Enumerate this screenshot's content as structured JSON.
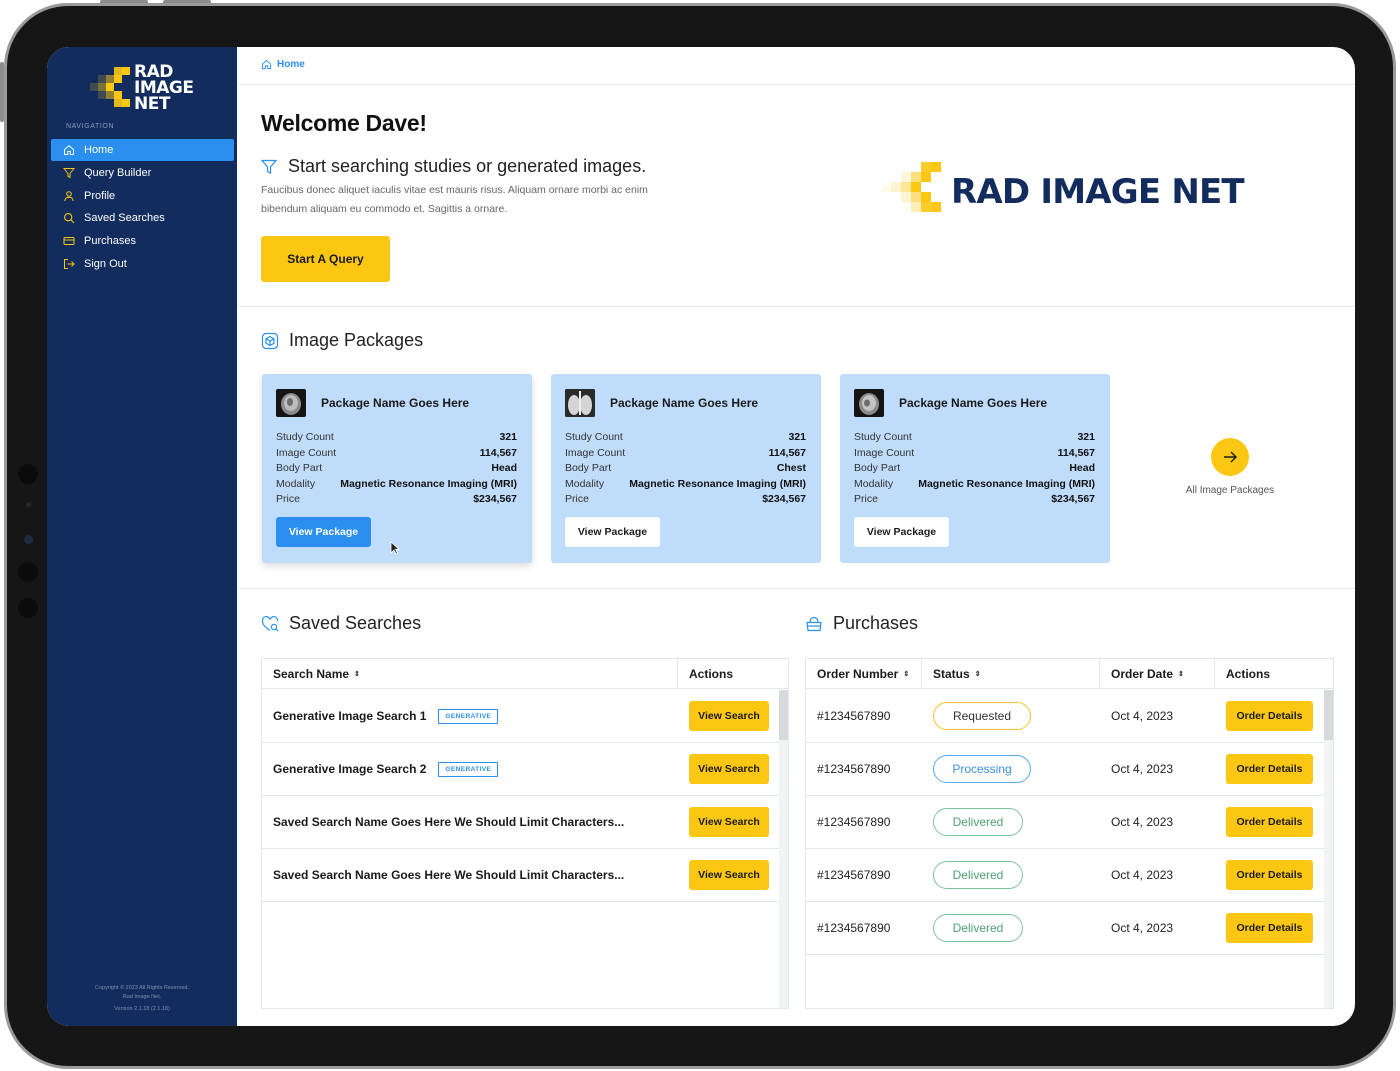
{
  "sidebar": {
    "logo_text": [
      "RAD",
      "IMAGE",
      "NET"
    ],
    "nav_heading": "NAVIGATION",
    "items": [
      {
        "label": "Home",
        "icon": "home-icon",
        "active": true
      },
      {
        "label": "Query Builder",
        "icon": "filter-icon",
        "active": false
      },
      {
        "label": "Profile",
        "icon": "user-icon",
        "active": false
      },
      {
        "label": "Saved Searches",
        "icon": "search-icon",
        "active": false
      },
      {
        "label": "Purchases",
        "icon": "card-icon",
        "active": false
      },
      {
        "label": "Sign Out",
        "icon": "signout-icon",
        "active": false
      }
    ],
    "copyright_line1": "Copyright © 2023 All Rights Reserved.",
    "copyright_line2": "Rad Image Net.",
    "version": "Version 2.1.18 (2.1.18)"
  },
  "breadcrumb": {
    "label": "Home",
    "icon": "home-icon"
  },
  "hero": {
    "welcome": "Welcome Dave!",
    "subhead": "Start searching studies or generated images.",
    "description": "Faucibus donec aliquet iaculis vitae est mauris risus. Aliquam ornare morbi ac enim bibendum aliquam eu commodo et. Sagittis a ornare.",
    "button": "Start A Query",
    "logo_text": "RAD IMAGE NET"
  },
  "packages": {
    "title": "Image Packages",
    "labels": {
      "study_count": "Study Count",
      "image_count": "Image Count",
      "body_part": "Body Part",
      "modality": "Modality",
      "price": "Price"
    },
    "items": [
      {
        "name": "Package Name Goes Here",
        "study_count": "321",
        "image_count": "114,567",
        "body_part": "Head",
        "modality": "Magnetic Resonance Imaging (MRI)",
        "price": "$234,567",
        "button": "View Package"
      },
      {
        "name": "Package Name Goes Here",
        "study_count": "321",
        "image_count": "114,567",
        "body_part": "Chest",
        "modality": "Magnetic Resonance Imaging (MRI)",
        "price": "$234,567",
        "button": "View Package"
      },
      {
        "name": "Package Name Goes Here",
        "study_count": "321",
        "image_count": "114,567",
        "body_part": "Head",
        "modality": "Magnetic Resonance Imaging (MRI)",
        "price": "$234,567",
        "button": "View Package"
      }
    ],
    "all_label": "All Image Packages"
  },
  "saved_searches": {
    "title": "Saved Searches",
    "columns": [
      "Search Name",
      "Actions"
    ],
    "sort_icon": "⇕",
    "rows": [
      {
        "name": "Generative Image Search 1",
        "tag": "GENERATIVE",
        "action": "View Search"
      },
      {
        "name": "Generative Image Search 2",
        "tag": "GENERATIVE",
        "action": "View Search"
      },
      {
        "name": "Saved Search Name Goes Here We Should Limit Characters...",
        "tag": "",
        "action": "View Search"
      },
      {
        "name": "Saved Search Name Goes Here We Should Limit Characters...",
        "tag": "",
        "action": "View Search"
      }
    ]
  },
  "purchases": {
    "title": "Purchases",
    "columns": [
      "Order Number",
      "Status",
      "Order Date",
      "Actions"
    ],
    "rows": [
      {
        "order": "#1234567890",
        "status": "Requested",
        "date": "Oct 4, 2023",
        "action": "Order Details"
      },
      {
        "order": "#1234567890",
        "status": "Processing",
        "date": "Oct 4, 2023",
        "action": "Order Details"
      },
      {
        "order": "#1234567890",
        "status": "Delivered",
        "date": "Oct 4, 2023",
        "action": "Order Details"
      },
      {
        "order": "#1234567890",
        "status": "Delivered",
        "date": "Oct 4, 2023",
        "action": "Order Details"
      },
      {
        "order": "#1234567890",
        "status": "Delivered",
        "date": "Oct 4, 2023",
        "action": "Order Details"
      }
    ]
  },
  "colors": {
    "navy": "#112c5d",
    "accent_blue": "#2b8ff0",
    "yellow": "#fcc713",
    "card_blue": "#bfdcfb"
  }
}
